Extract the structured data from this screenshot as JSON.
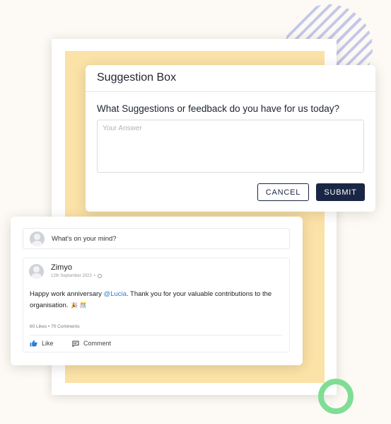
{
  "suggestion_box": {
    "title": "Suggestion Box",
    "question": "What Suggestions or feedback do you have for us today?",
    "answer_placeholder": "Your Answer",
    "cancel_label": "CANCEL",
    "submit_label": "SUBMIT"
  },
  "feed": {
    "post_prompt": "What's on your mind?",
    "post": {
      "author": "Zimyo",
      "date": "12th September 2023",
      "date_separator": "•",
      "text_before": "Happy work anniversary ",
      "mention": "@Lucia",
      "text_after": ". Thank you for your valuable contributions to the organisation.",
      "emojis": "🎉 🎊",
      "likes": "60 Likes",
      "stats_separator": "•",
      "comments": "70 Comments",
      "like_label": "Like",
      "comment_label": "Comment"
    }
  },
  "colors": {
    "navy": "#1a2645",
    "highlight": "#fbe2a6",
    "mention": "#2a7fd4",
    "like_icon": "#2a7fd4",
    "ring": "#7ede95",
    "stripes": "#b9bfe7"
  },
  "icons": {
    "post_visibility": "globe-icon",
    "like": "thumbs-up-icon",
    "comment": "comment-icon",
    "avatar": "user-avatar-icon"
  }
}
